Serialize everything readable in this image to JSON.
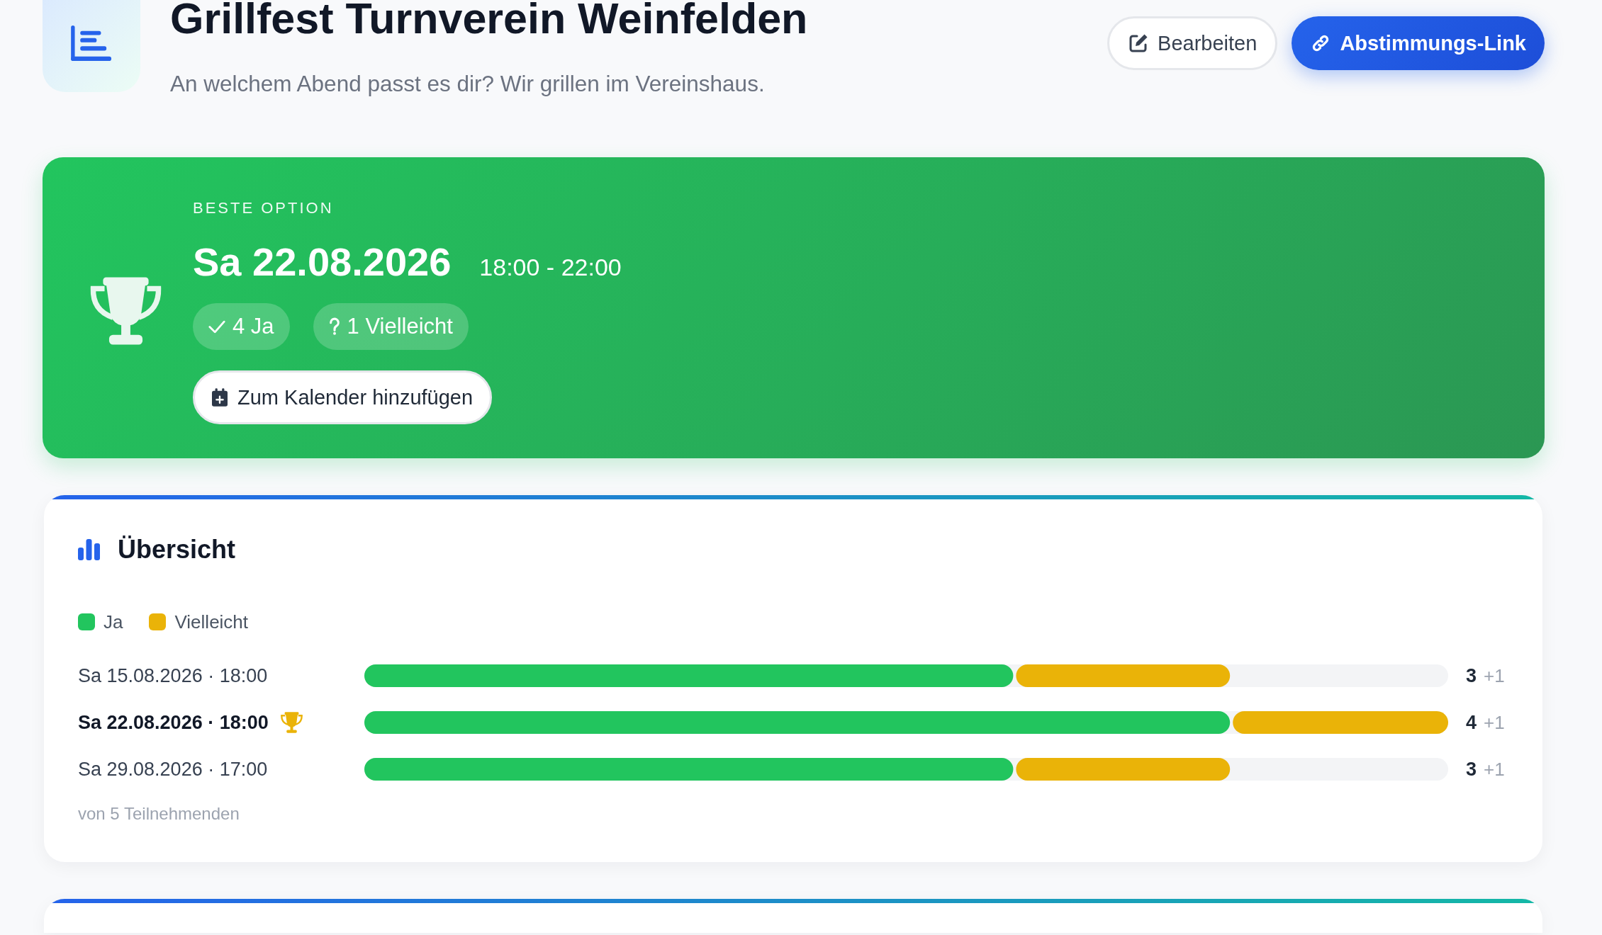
{
  "header": {
    "title": "Grillfest Turnverein Weinfelden",
    "subtitle": "An welchem Abend passt es dir? Wir grillen im Vereinshaus.",
    "actions": [
      {
        "kind": "edit",
        "label": "Bearbeiten"
      },
      {
        "kind": "share",
        "label": "Abstimmungs-Link"
      }
    ]
  },
  "best_option": {
    "eyebrow": "BESTE OPTION",
    "date": "Sa 22.08.2026",
    "time": "18:00 - 22:00",
    "badges": [
      {
        "kind": "yes",
        "label": "4 Ja"
      },
      {
        "kind": "maybe",
        "label": "1 Vielleicht"
      }
    ],
    "calendar_button": "Zum Kalender hinzufügen"
  },
  "overview": {
    "title": "Übersicht",
    "chart_data": {
      "type": "bar",
      "orientation": "horizontal",
      "stacked": true,
      "legend": "top",
      "categories": [
        "Sa 15.08.2026 · 18:00",
        "Sa 22.08.2026 · 18:00",
        "Sa 29.08.2026 · 17:00"
      ],
      "series": [
        {
          "name": "Ja",
          "color": "#22c55e",
          "values": [
            3,
            4,
            3
          ],
          "value_labels": [
            "3",
            "4",
            "3"
          ]
        },
        {
          "name": "Vielleicht",
          "color": "#eab308",
          "values": [
            1,
            1,
            1
          ],
          "value_labels": [
            "+1",
            "+1",
            "+1"
          ]
        }
      ],
      "data_labels": true
    },
    "options": [
      {
        "best": false
      },
      {
        "best": true
      },
      {
        "best": false
      }
    ],
    "footnote": "von 5 Teilnehmenden"
  }
}
